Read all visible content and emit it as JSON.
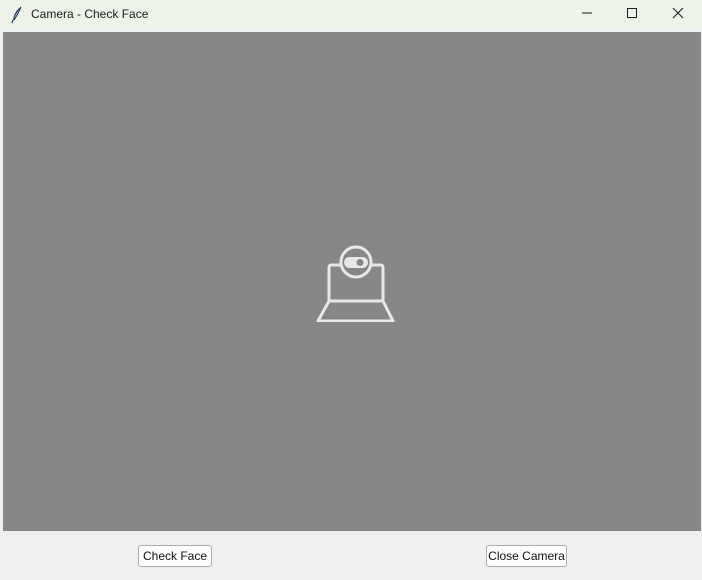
{
  "window": {
    "title": "Camera - Check Face",
    "app_icon": "feather-icon",
    "controls": [
      "minimize-icon",
      "maximize-icon",
      "close-icon"
    ]
  },
  "viewport": {
    "placeholder_icon": "webcam-icon",
    "background_color": "#87878a"
  },
  "buttons": {
    "check_face": "Check Face",
    "close_camera": "Close Camera"
  }
}
